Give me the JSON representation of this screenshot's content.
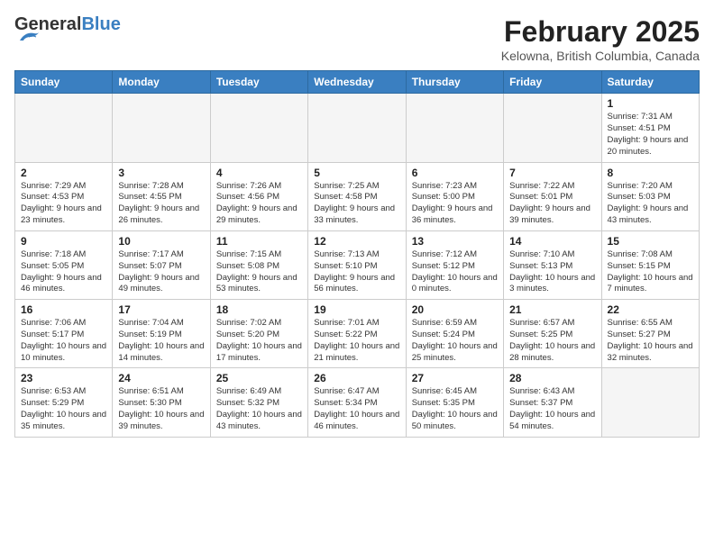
{
  "header": {
    "logo_general": "General",
    "logo_blue": "Blue",
    "month_title": "February 2025",
    "location": "Kelowna, British Columbia, Canada"
  },
  "weekdays": [
    "Sunday",
    "Monday",
    "Tuesday",
    "Wednesday",
    "Thursday",
    "Friday",
    "Saturday"
  ],
  "weeks": [
    [
      {
        "day": "",
        "info": ""
      },
      {
        "day": "",
        "info": ""
      },
      {
        "day": "",
        "info": ""
      },
      {
        "day": "",
        "info": ""
      },
      {
        "day": "",
        "info": ""
      },
      {
        "day": "",
        "info": ""
      },
      {
        "day": "1",
        "info": "Sunrise: 7:31 AM\nSunset: 4:51 PM\nDaylight: 9 hours and 20 minutes."
      }
    ],
    [
      {
        "day": "2",
        "info": "Sunrise: 7:29 AM\nSunset: 4:53 PM\nDaylight: 9 hours and 23 minutes."
      },
      {
        "day": "3",
        "info": "Sunrise: 7:28 AM\nSunset: 4:55 PM\nDaylight: 9 hours and 26 minutes."
      },
      {
        "day": "4",
        "info": "Sunrise: 7:26 AM\nSunset: 4:56 PM\nDaylight: 9 hours and 29 minutes."
      },
      {
        "day": "5",
        "info": "Sunrise: 7:25 AM\nSunset: 4:58 PM\nDaylight: 9 hours and 33 minutes."
      },
      {
        "day": "6",
        "info": "Sunrise: 7:23 AM\nSunset: 5:00 PM\nDaylight: 9 hours and 36 minutes."
      },
      {
        "day": "7",
        "info": "Sunrise: 7:22 AM\nSunset: 5:01 PM\nDaylight: 9 hours and 39 minutes."
      },
      {
        "day": "8",
        "info": "Sunrise: 7:20 AM\nSunset: 5:03 PM\nDaylight: 9 hours and 43 minutes."
      }
    ],
    [
      {
        "day": "9",
        "info": "Sunrise: 7:18 AM\nSunset: 5:05 PM\nDaylight: 9 hours and 46 minutes."
      },
      {
        "day": "10",
        "info": "Sunrise: 7:17 AM\nSunset: 5:07 PM\nDaylight: 9 hours and 49 minutes."
      },
      {
        "day": "11",
        "info": "Sunrise: 7:15 AM\nSunset: 5:08 PM\nDaylight: 9 hours and 53 minutes."
      },
      {
        "day": "12",
        "info": "Sunrise: 7:13 AM\nSunset: 5:10 PM\nDaylight: 9 hours and 56 minutes."
      },
      {
        "day": "13",
        "info": "Sunrise: 7:12 AM\nSunset: 5:12 PM\nDaylight: 10 hours and 0 minutes."
      },
      {
        "day": "14",
        "info": "Sunrise: 7:10 AM\nSunset: 5:13 PM\nDaylight: 10 hours and 3 minutes."
      },
      {
        "day": "15",
        "info": "Sunrise: 7:08 AM\nSunset: 5:15 PM\nDaylight: 10 hours and 7 minutes."
      }
    ],
    [
      {
        "day": "16",
        "info": "Sunrise: 7:06 AM\nSunset: 5:17 PM\nDaylight: 10 hours and 10 minutes."
      },
      {
        "day": "17",
        "info": "Sunrise: 7:04 AM\nSunset: 5:19 PM\nDaylight: 10 hours and 14 minutes."
      },
      {
        "day": "18",
        "info": "Sunrise: 7:02 AM\nSunset: 5:20 PM\nDaylight: 10 hours and 17 minutes."
      },
      {
        "day": "19",
        "info": "Sunrise: 7:01 AM\nSunset: 5:22 PM\nDaylight: 10 hours and 21 minutes."
      },
      {
        "day": "20",
        "info": "Sunrise: 6:59 AM\nSunset: 5:24 PM\nDaylight: 10 hours and 25 minutes."
      },
      {
        "day": "21",
        "info": "Sunrise: 6:57 AM\nSunset: 5:25 PM\nDaylight: 10 hours and 28 minutes."
      },
      {
        "day": "22",
        "info": "Sunrise: 6:55 AM\nSunset: 5:27 PM\nDaylight: 10 hours and 32 minutes."
      }
    ],
    [
      {
        "day": "23",
        "info": "Sunrise: 6:53 AM\nSunset: 5:29 PM\nDaylight: 10 hours and 35 minutes."
      },
      {
        "day": "24",
        "info": "Sunrise: 6:51 AM\nSunset: 5:30 PM\nDaylight: 10 hours and 39 minutes."
      },
      {
        "day": "25",
        "info": "Sunrise: 6:49 AM\nSunset: 5:32 PM\nDaylight: 10 hours and 43 minutes."
      },
      {
        "day": "26",
        "info": "Sunrise: 6:47 AM\nSunset: 5:34 PM\nDaylight: 10 hours and 46 minutes."
      },
      {
        "day": "27",
        "info": "Sunrise: 6:45 AM\nSunset: 5:35 PM\nDaylight: 10 hours and 50 minutes."
      },
      {
        "day": "28",
        "info": "Sunrise: 6:43 AM\nSunset: 5:37 PM\nDaylight: 10 hours and 54 minutes."
      },
      {
        "day": "",
        "info": ""
      }
    ]
  ]
}
